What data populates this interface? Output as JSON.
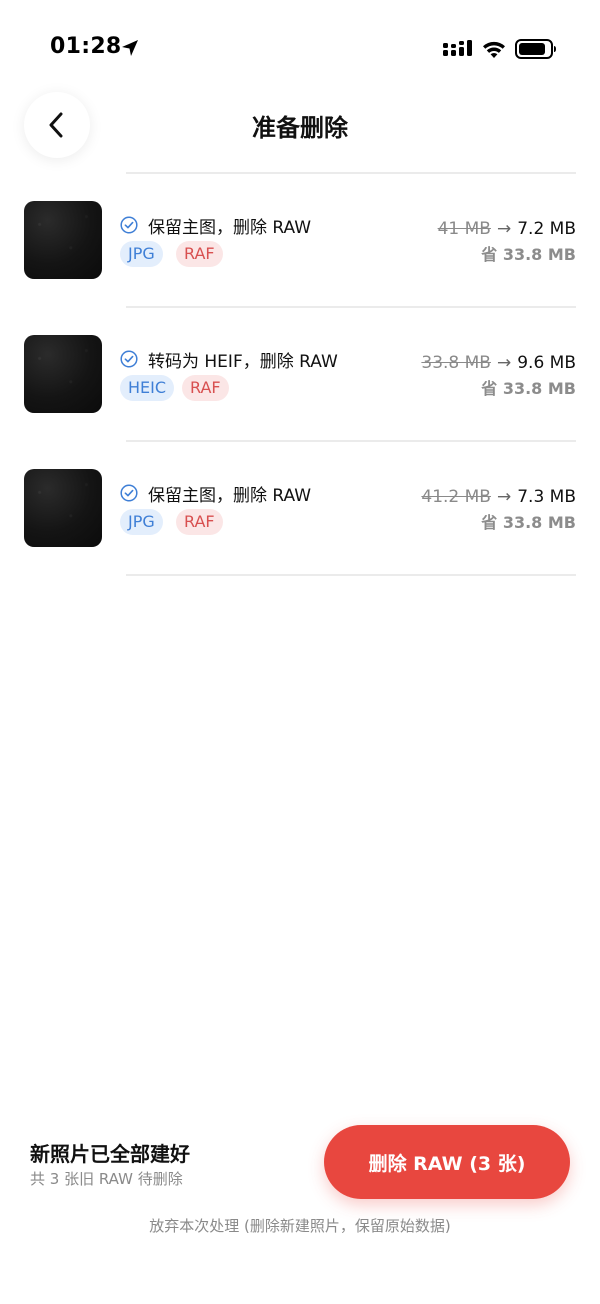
{
  "status_bar": {
    "time": "01:28"
  },
  "header": {
    "title": "准备删除"
  },
  "items": [
    {
      "action": "保留主图，删除 RAW",
      "tags": [
        {
          "label": "JPG",
          "color": "blue"
        },
        {
          "label": "RAF",
          "color": "red"
        }
      ],
      "old_size": "41 MB",
      "arrow": "→",
      "new_size": "7.2 MB",
      "saved": "省 33.8 MB"
    },
    {
      "action": "转码为 HEIF，删除 RAW",
      "tags": [
        {
          "label": "HEIC",
          "color": "blue"
        },
        {
          "label": "RAF",
          "color": "red"
        }
      ],
      "old_size": "33.8 MB",
      "arrow": "→",
      "new_size": "9.6 MB",
      "saved": "省 33.8 MB"
    },
    {
      "action": "保留主图，删除 RAW",
      "tags": [
        {
          "label": "JPG",
          "color": "blue"
        },
        {
          "label": "RAF",
          "color": "red"
        }
      ],
      "old_size": "41.2 MB",
      "arrow": "→",
      "new_size": "7.3 MB",
      "saved": "省 33.8 MB"
    }
  ],
  "footer": {
    "summary_title": "新照片已全部建好",
    "summary_sub": "共 3 张旧 RAW 待删除",
    "delete_button": "删除 RAW (3 张)",
    "abandon_link": "放弃本次处理 (删除新建照片，保留原始数据)"
  },
  "colors": {
    "accent_red": "#e8473f",
    "tag_blue_text": "#3f7fd6",
    "tag_blue_bg": "#e3eefc",
    "tag_red_text": "#d85050",
    "tag_red_bg": "#fbe6e6",
    "check_blue": "#3f7fd6"
  },
  "icons": {
    "location": "location-arrow-icon",
    "signal": "cellular-signal-icon",
    "wifi": "wifi-icon",
    "battery": "battery-icon",
    "back": "chevron-left-icon",
    "check": "check-circle-icon"
  }
}
